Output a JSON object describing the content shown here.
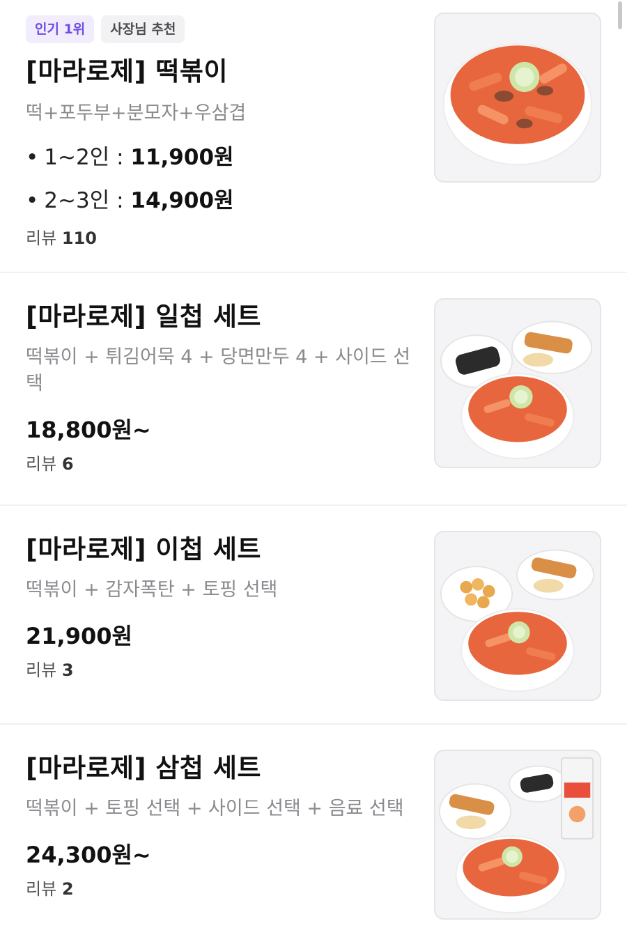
{
  "menu_items": [
    {
      "badges": [
        "인기 1위",
        "사장님 추천"
      ],
      "title": "[마라로제] 떡볶이",
      "description": "떡+포두부+분모자+우삼겹",
      "price_options": [
        {
          "label": "1~2인 : ",
          "price": "11,900원"
        },
        {
          "label": "2~3인 : ",
          "price": "14,900원"
        }
      ],
      "review_label": "리뷰",
      "review_count": "110"
    },
    {
      "title": "[마라로제] 일첩 세트",
      "description": "떡볶이 + 튀김어묵 4 + 당면만두 4 + 사이드 선택",
      "price": "18,800원~",
      "review_label": "리뷰",
      "review_count": "6"
    },
    {
      "title": "[마라로제] 이첩 세트",
      "description": "떡볶이 + 감자폭탄 + 토핑 선택",
      "price": "21,900원",
      "review_label": "리뷰",
      "review_count": "3"
    },
    {
      "title": "[마라로제] 삼첩 세트",
      "description": "떡볶이 + 토핑 선택 + 사이드 선택 + 음료 선택",
      "price": "24,300원~",
      "review_label": "리뷰",
      "review_count": "2"
    }
  ],
  "colors": {
    "badge_popular": "#6f4ce6",
    "divider": "#f1f1f3",
    "sauce": "#e8663d"
  },
  "icons": {
    "scrollbar": "scroll-indicator"
  }
}
